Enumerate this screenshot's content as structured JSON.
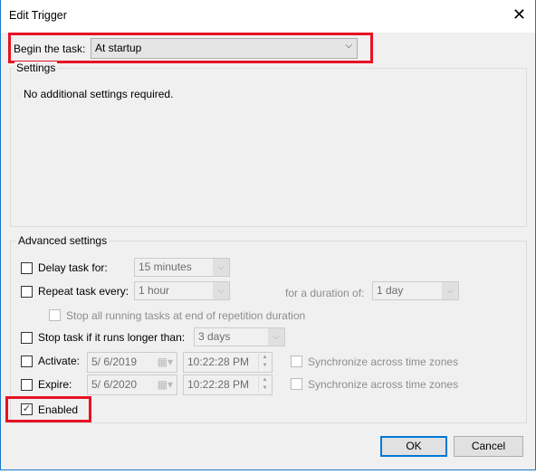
{
  "title": "Edit Trigger",
  "begin": {
    "label": "Begin the task:",
    "value": "At startup"
  },
  "settings": {
    "label": "Settings",
    "text": "No additional settings required."
  },
  "advanced": {
    "label": "Advanced settings",
    "delay": {
      "label": "Delay task for:",
      "value": "15 minutes",
      "checked": false
    },
    "repeat": {
      "label": "Repeat task every:",
      "value": "1 hour",
      "checked": false,
      "duration_label": "for a duration of:",
      "duration_value": "1 day"
    },
    "stop_running": {
      "label": "Stop all running tasks at end of repetition duration",
      "checked": false
    },
    "stop_longer": {
      "label": "Stop task if it runs longer than:",
      "value": "3 days",
      "checked": false
    },
    "activate": {
      "label": "Activate:",
      "date": "5/  6/2019",
      "time": "10:22:28 PM",
      "sync": "Synchronize across time zones",
      "checked": false
    },
    "expire": {
      "label": "Expire:",
      "date": "5/  6/2020",
      "time": "10:22:28 PM",
      "sync": "Synchronize across time zones",
      "checked": false
    },
    "enabled": {
      "label": "Enabled",
      "checked": true
    }
  },
  "buttons": {
    "ok": "OK",
    "cancel": "Cancel"
  },
  "colors": {
    "highlight": "#e81123",
    "accent": "#0078d7"
  }
}
